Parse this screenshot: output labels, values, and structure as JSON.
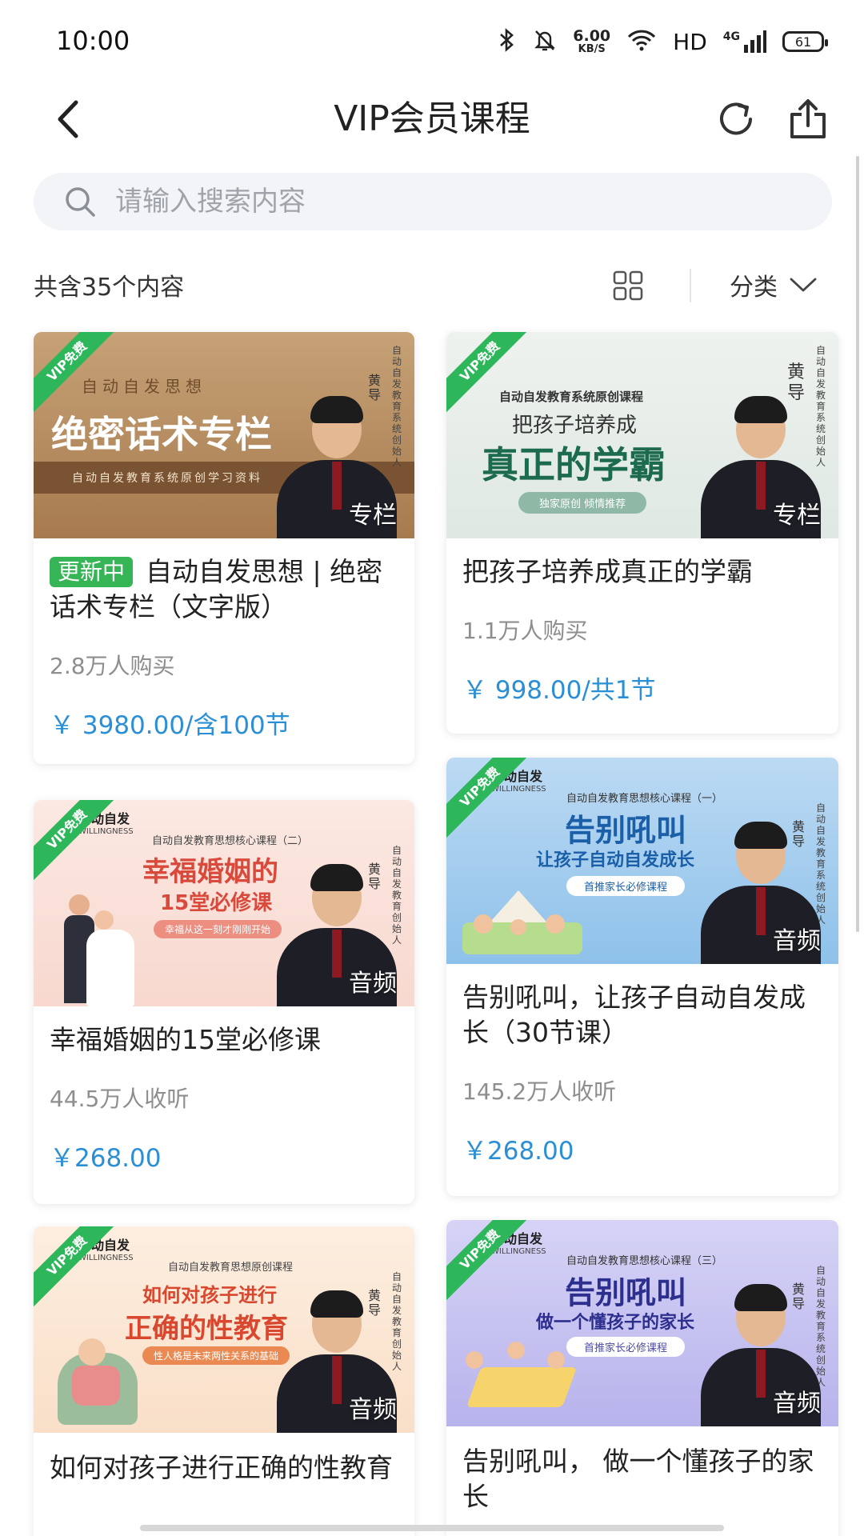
{
  "status_bar": {
    "time": "10:00",
    "net_speed_value": "6.00",
    "net_speed_unit": "KB/S",
    "hd": "HD",
    "signal": "4G",
    "battery": "61"
  },
  "nav": {
    "title": "VIP会员课程",
    "back_icon": "chevron-left-icon",
    "refresh_icon": "refresh-icon",
    "share_icon": "share-icon"
  },
  "search": {
    "placeholder": "请输入搜索内容"
  },
  "filter": {
    "total": "共含35个内容",
    "category": "分类"
  },
  "colors": {
    "accent_green": "#35b555",
    "price_blue": "#2b8fd6"
  },
  "courses": [
    {
      "ribbon": "VIP免费",
      "tag": "专栏",
      "badge": "更新中",
      "title": "自动自发思想 | 绝密话术专栏（文字版）",
      "stats": "2.8万人购买",
      "price": "￥ 3980.00/含100节",
      "banner": {
        "top": "自动自发思想",
        "main": "绝密话术专栏",
        "sub": "自动自发教育系统原创学习资料",
        "side": "自动自发教育系统创始人",
        "name": "黄导"
      }
    },
    {
      "ribbon": "VIP免费",
      "tag": "专栏",
      "title": "把孩子培养成真正的学霸",
      "stats": "1.1万人购买",
      "price": "￥ 998.00/共1节",
      "banner": {
        "top": "自动自发教育系统原创课程",
        "line1": "把孩子培养成",
        "main": "真正的学霸",
        "pill": "独家原创  倾情推荐",
        "side": "自动自发教育系统创始人",
        "name": "黄导"
      }
    },
    {
      "ribbon": "VIP免费",
      "tag": "音频",
      "title": "幸福婚姻的15堂必修课",
      "stats": "44.5万人收听",
      "price": "￥268.00",
      "banner": {
        "brand": "自动自发",
        "brand_en": "WILLINGNESS",
        "top": "自动自发教育思想核心课程（二）",
        "main": "幸福婚姻的",
        "line2": "15堂必修课",
        "pill": "幸福从这一刻才刚刚开始",
        "side": "自动自发教育创始人",
        "name": "黄导"
      }
    },
    {
      "ribbon": "VIP免费",
      "tag": "音频",
      "title": "告别吼叫，让孩子自动自发成长（30节课）",
      "stats": "145.2万人收听",
      "price": "￥268.00",
      "banner": {
        "brand": "自动自发",
        "brand_en": "WILLINGNESS",
        "top": "自动自发教育思想核心课程（一）",
        "main": "告别吼叫",
        "line2": "让孩子自动自发成长",
        "pill": "首推家长必修课程",
        "side": "自动自发教育系统创始人",
        "name": "黄导"
      }
    },
    {
      "ribbon": "VIP免费",
      "tag": "音频",
      "title": "如何对孩子进行正确的性教育",
      "banner": {
        "brand": "自动自发",
        "brand_en": "WILLINGNESS",
        "top": "自动自发教育思想原创课程",
        "line1": "如何对孩子进行",
        "main": "正确的性教育",
        "pill": "性人格是未来两性关系的基础",
        "side": "自动自发教育创始人",
        "name": "黄导"
      }
    },
    {
      "ribbon": "VIP免费",
      "tag": "音频",
      "title": "告别吼叫， 做一个懂孩子的家长",
      "banner": {
        "brand": "自动自发",
        "brand_en": "WILLINGNESS",
        "top": "自动自发教育思想核心课程（三）",
        "main": "告别吼叫",
        "line2": "做一个懂孩子的家长",
        "pill": "首推家长必修课程",
        "side": "自动自发教育系统创始人",
        "name": "黄导"
      }
    }
  ]
}
